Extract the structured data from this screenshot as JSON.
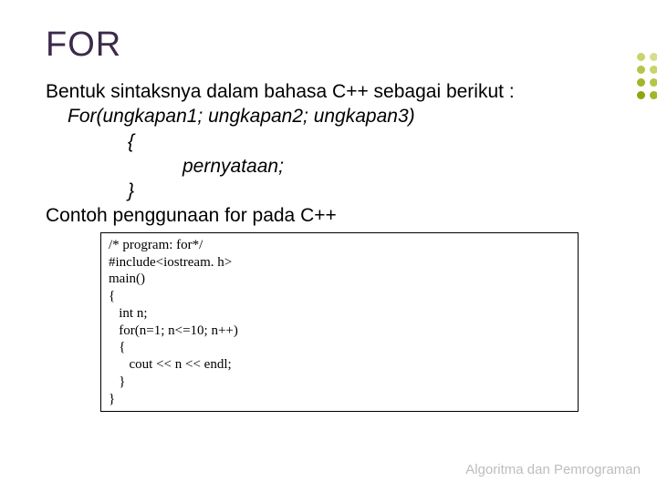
{
  "title": "FOR",
  "intro": "Bentuk sintaksnya dalam bahasa C++ sebagai berikut :",
  "syntax": {
    "for_line": "For(ungkapan1; ungkapan2; ungkapan3)",
    "open_brace": "{",
    "statement": "pernyataan;",
    "close_brace": "}"
  },
  "example_heading": "Contoh penggunaan for pada C++",
  "code": {
    "l1": "/* program: for*/",
    "l2": "#include<iostream. h>",
    "l3": "main()",
    "l4": "{",
    "l5": "   int n;",
    "l6": "   for(n=1; n<=10; n++)",
    "l7": "   {",
    "l8": "      cout << n << endl;",
    "l9": "   }",
    "l10": "}"
  },
  "footer": "Algoritma dan Pemrograman"
}
